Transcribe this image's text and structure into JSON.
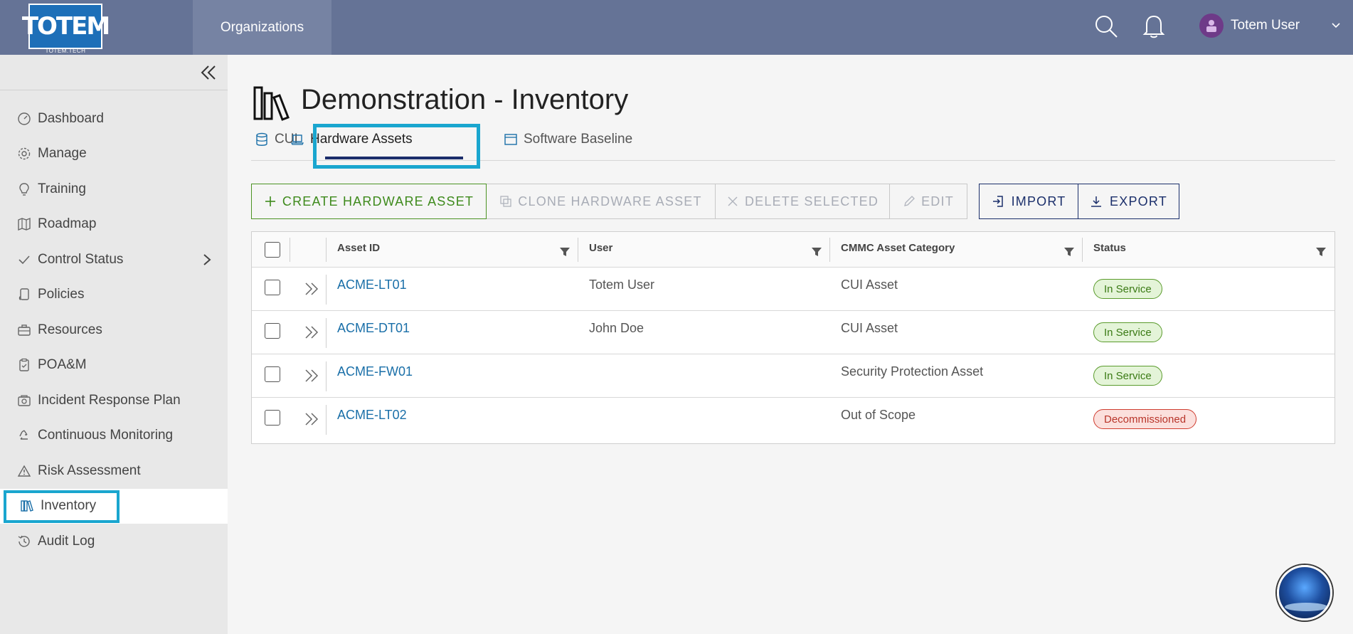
{
  "header": {
    "logo_text": "TOTEM",
    "logo_sub": "TOTEM.TECH",
    "nav_label": "Organizations",
    "user_name": "Totem User",
    "colors": {
      "bar": "#657396",
      "active_nav": "#7683a3"
    }
  },
  "sidebar": {
    "items": [
      {
        "label": "Dashboard",
        "icon": "gauge-icon"
      },
      {
        "label": "Manage",
        "icon": "gear-icon"
      },
      {
        "label": "Training",
        "icon": "lightbulb-icon"
      },
      {
        "label": "Roadmap",
        "icon": "map-icon"
      },
      {
        "label": "Control Status",
        "icon": "check-icon"
      },
      {
        "label": "Policies",
        "icon": "scroll-icon"
      },
      {
        "label": "Resources",
        "icon": "toolbox-icon"
      },
      {
        "label": "POA&M",
        "icon": "clipboard-icon"
      },
      {
        "label": "Incident Response Plan",
        "icon": "camera-icon"
      },
      {
        "label": "Continuous Monitoring",
        "icon": "recycle-icon"
      },
      {
        "label": "Risk Assessment",
        "icon": "warning-icon"
      },
      {
        "label": "Inventory",
        "icon": "books-icon",
        "active": true
      },
      {
        "label": "Audit Log",
        "icon": "history-icon"
      }
    ]
  },
  "page": {
    "title": "Demonstration - Inventory"
  },
  "tabs": [
    {
      "label": "CUI",
      "icon": "database-icon"
    },
    {
      "label": "Hardware Assets",
      "icon": "laptop-icon",
      "active": true
    },
    {
      "label": "Software Baseline",
      "icon": "window-icon"
    }
  ],
  "toolbar": {
    "create": "CREATE HARDWARE ASSET",
    "clone": "CLONE HARDWARE ASSET",
    "delete": "DELETE SELECTED",
    "edit": "EDIT",
    "import": "IMPORT",
    "export": "EXPORT"
  },
  "grid": {
    "columns": [
      "Asset ID",
      "User",
      "CMMC Asset Category",
      "Status"
    ],
    "rows": [
      {
        "asset_id": "ACME-LT01",
        "user": "Totem User",
        "category": "CUI Asset",
        "status": "In Service",
        "status_kind": "ok"
      },
      {
        "asset_id": "ACME-DT01",
        "user": "John Doe",
        "category": "CUI Asset",
        "status": "In Service",
        "status_kind": "ok"
      },
      {
        "asset_id": "ACME-FW01",
        "user": "",
        "category": "Security Protection Asset",
        "status": "In Service",
        "status_kind": "ok"
      },
      {
        "asset_id": "ACME-LT02",
        "user": "",
        "category": "Out of Scope",
        "status": "Decommissioned",
        "status_kind": "bad"
      }
    ]
  }
}
